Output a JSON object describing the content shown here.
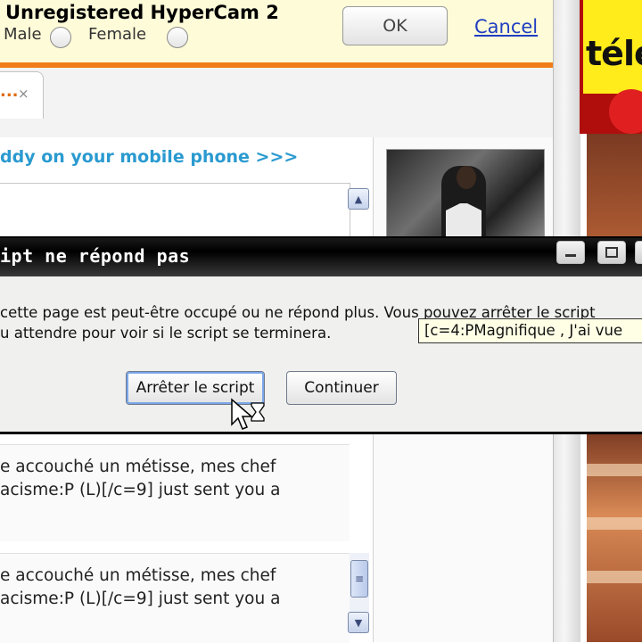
{
  "watermark": "Unregistered HyperCam 2",
  "form": {
    "male_label": "Male",
    "female_label": "Female",
    "ok_label": "OK",
    "cancel_label": "Cancel"
  },
  "tab": {
    "label": "...",
    "close_icon": "×"
  },
  "promo": "ddy on your mobile phone >>>",
  "ad": {
    "text": "télé"
  },
  "dialog": {
    "title": "ipt ne répond pas",
    "message_line1": "cette page est peut-être occupé ou ne répond plus. Vous pouvez arrêter le script",
    "message_line2": "u attendre pour voir si le script se terminera.",
    "tooltip": "[c=4:PMagnifique , J'ai vue",
    "stop_label": "Arrêter le script",
    "continue_label": "Continuer"
  },
  "messages": [
    {
      "line1": "e accouché un métisse, mes chef",
      "line2": "acisme:P (L)[/c=9] just sent you a"
    },
    {
      "line1": "e accouché un métisse, mes chef",
      "line2": "acisme:P (L)[/c=9] just sent you a"
    }
  ],
  "colors": {
    "accent_orange": "#f07d1a",
    "link_blue": "#1f3ec2",
    "promo_blue": "#2a9ad0"
  }
}
